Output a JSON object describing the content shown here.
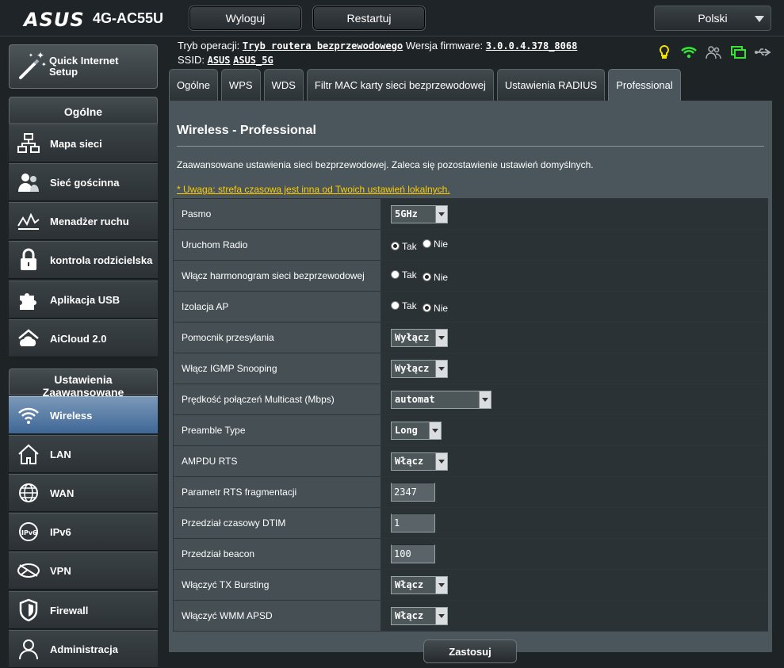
{
  "header": {
    "brand": "ASUS",
    "model": "4G-AC55U",
    "logout_label": "Wyloguj",
    "restart_label": "Restartuj",
    "language": "Polski"
  },
  "status": {
    "op_mode_label": "Tryb operacji:",
    "op_mode_value": "Tryb routera bezprzewodowego",
    "firmware_label": "Wersja firmware:",
    "firmware_value": "3.0.0.4.378_8068",
    "ssid_label": "SSID:",
    "ssid_1": "ASUS",
    "ssid_2": "ASUS_5G"
  },
  "sidebar": {
    "qis_label_1": "Quick Internet",
    "qis_label_2": "Setup",
    "general_header": "Ogólne",
    "general_items": [
      {
        "label": "Mapa sieci"
      },
      {
        "label": "Sieć gościnna"
      },
      {
        "label": "Menadżer ruchu"
      },
      {
        "label": "kontrola rodzicielska"
      },
      {
        "label": "Aplikacja USB"
      },
      {
        "label": "AiCloud 2.0"
      }
    ],
    "advanced_header_1": "Ustawienia",
    "advanced_header_2": "Zaawansowane",
    "advanced_items": [
      {
        "label": "Wireless"
      },
      {
        "label": "LAN"
      },
      {
        "label": "WAN"
      },
      {
        "label": "IPv6"
      },
      {
        "label": "VPN"
      },
      {
        "label": "Firewall"
      },
      {
        "label": "Administracja"
      }
    ]
  },
  "tabs": [
    {
      "label": "Ogólne"
    },
    {
      "label": "WPS"
    },
    {
      "label": "WDS"
    },
    {
      "label": "Filtr MAC karty sieci bezprzewodowej"
    },
    {
      "label": "Ustawienia RADIUS"
    },
    {
      "label": "Professional"
    }
  ],
  "panel": {
    "title": "Wireless - Professional",
    "description": "Zaawansowane ustawienia sieci bezprzewodowej. Zaleca się pozostawienie ustawień domyślnych.",
    "warning": "* Uwaga: strefa czasowa jest inna od Twoich ustawień lokalnych.",
    "apply_label": "Zastosuj"
  },
  "settings": [
    {
      "label": "Pasmo",
      "value": "5GHz"
    },
    {
      "label": "Uruchom Radio",
      "opt_yes": "Tak",
      "opt_no": "Nie"
    },
    {
      "label": "Włącz harmonogram sieci bezprzewodowej",
      "opt_yes": "Tak",
      "opt_no": "Nie"
    },
    {
      "label": "Izolacja AP",
      "opt_yes": "Tak",
      "opt_no": "Nie"
    },
    {
      "label": "Pomocnik przesyłania",
      "value": "Wyłącz"
    },
    {
      "label": "Włącz IGMP Snooping",
      "value": "Wyłącz"
    },
    {
      "label": "Prędkość połączeń Multicast (Mbps)",
      "value": "automat"
    },
    {
      "label": "Preamble Type",
      "value": "Long"
    },
    {
      "label": "AMPDU RTS",
      "value": "Włącz"
    },
    {
      "label": "Parametr RTS fragmentacji",
      "value": "2347"
    },
    {
      "label": "Przedział czasowy DTIM",
      "value": "1"
    },
    {
      "label": "Przedział beacon",
      "value": "100"
    },
    {
      "label": "Włączyć TX Bursting",
      "value": "Włącz"
    },
    {
      "label": "Włączyć WMM APSD",
      "value": "Włącz"
    }
  ]
}
